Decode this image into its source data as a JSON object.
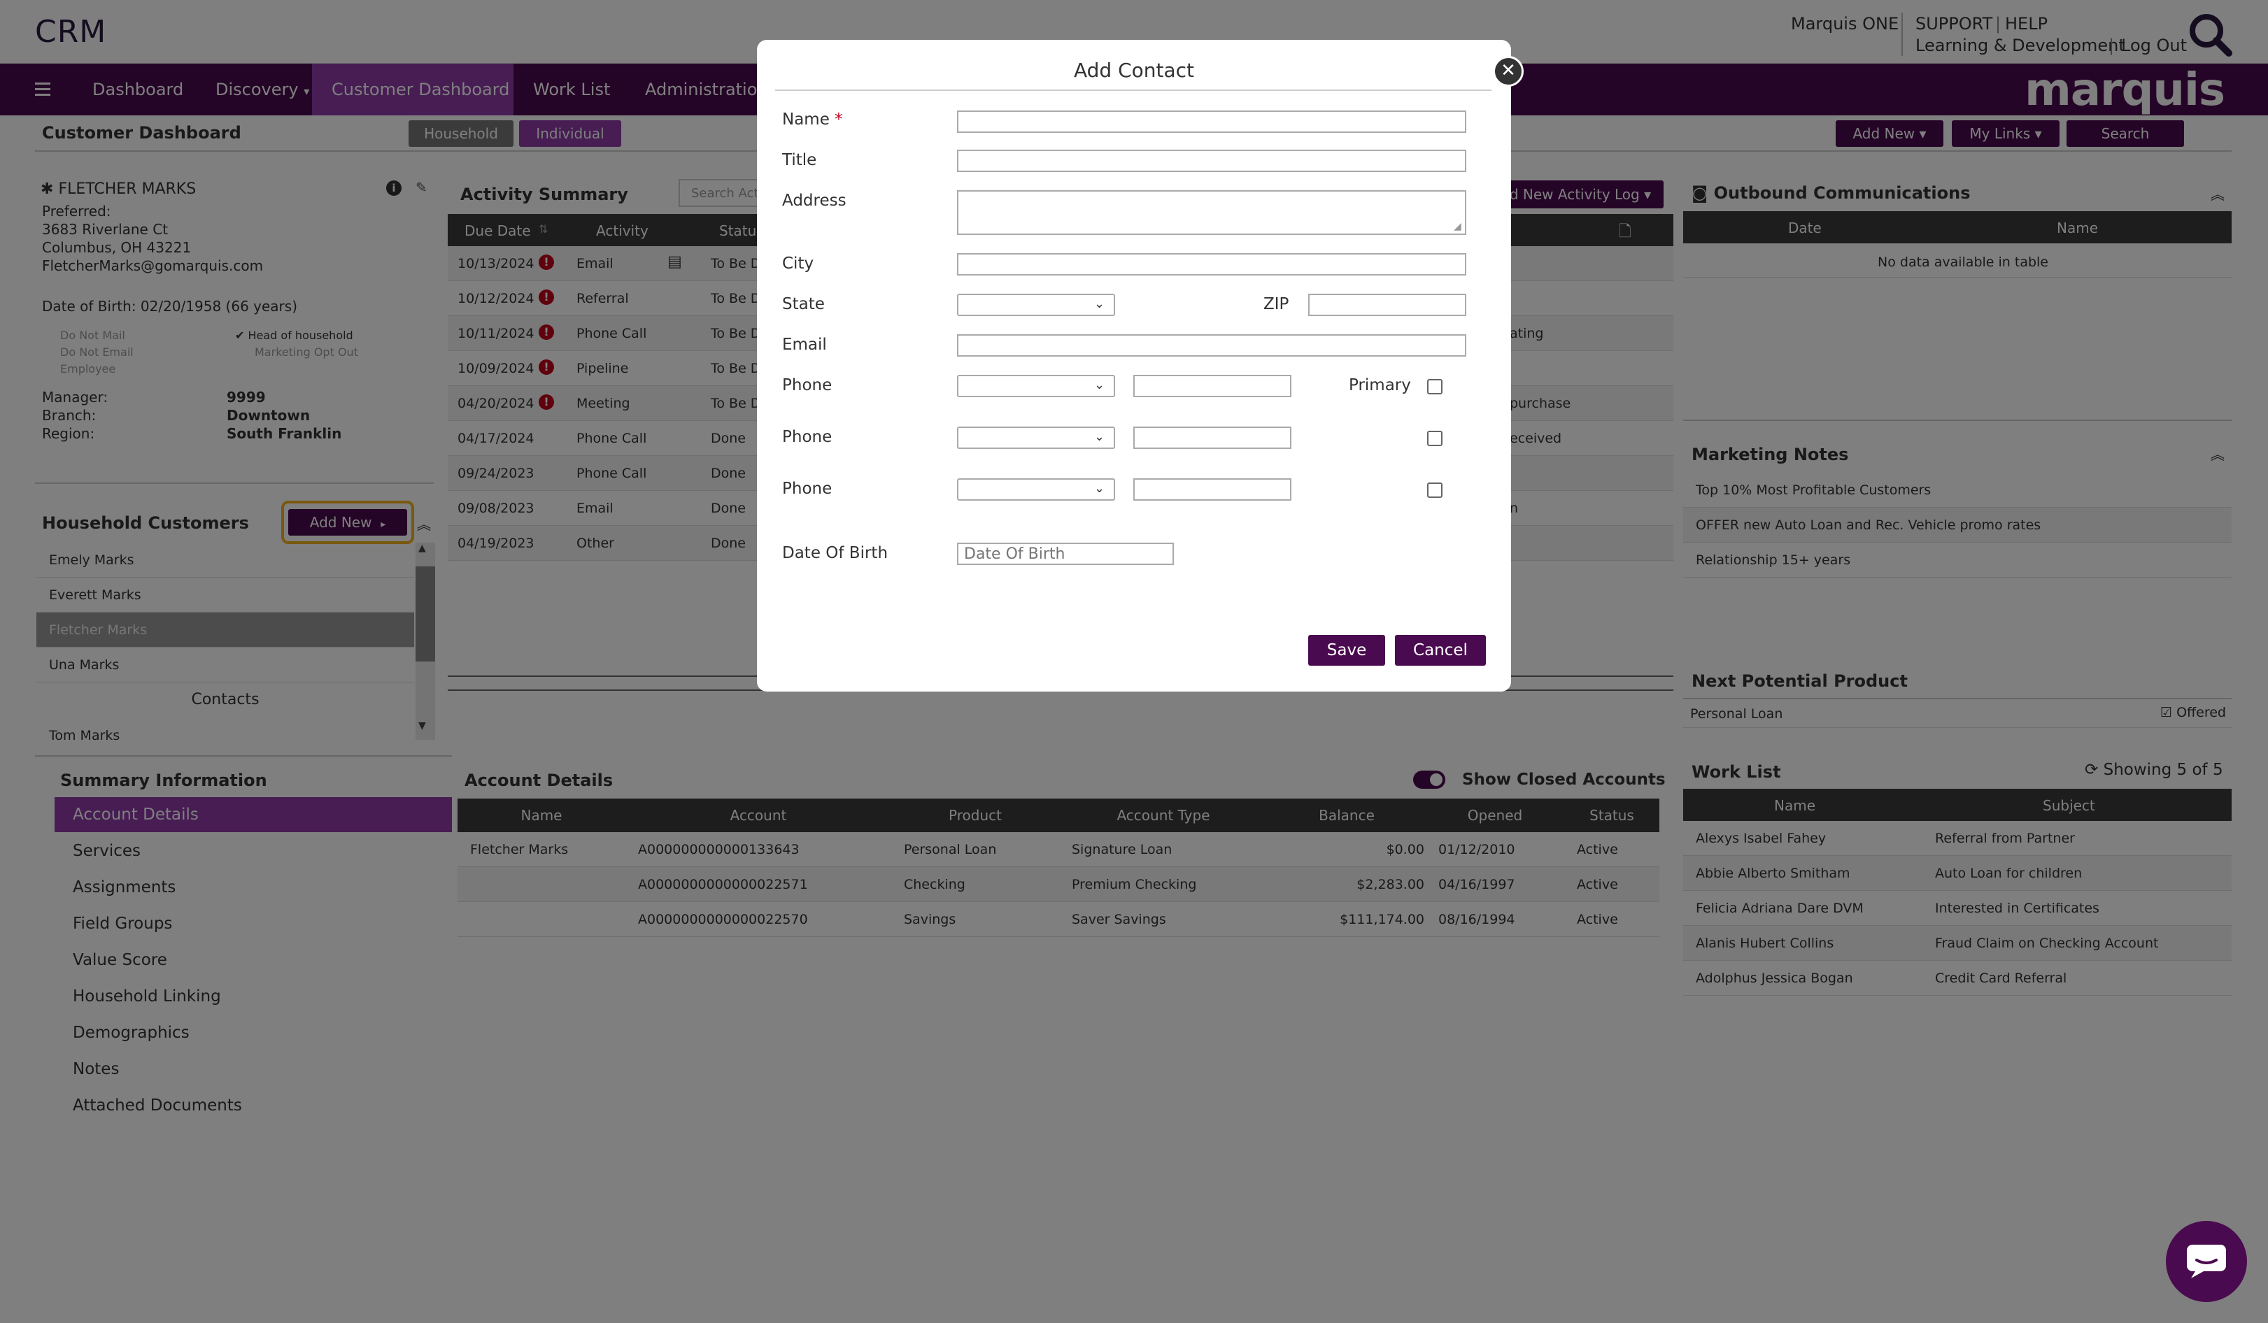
{
  "app": {
    "title": "CRM",
    "brand": "marquis",
    "top_links": {
      "marquis_one": "Marquis ONE",
      "support": "SUPPORT",
      "help": "HELP",
      "learning": "Learning & Development",
      "logout": "Log Out",
      "sep": "|"
    }
  },
  "nav": {
    "items": [
      {
        "label": "Dashboard"
      },
      {
        "label": "Discovery"
      },
      {
        "label": "Customer Dashboard"
      },
      {
        "label": "Work List"
      },
      {
        "label": "Administration"
      }
    ]
  },
  "subheader": {
    "title": "Customer Dashboard",
    "household_tab": "Household",
    "individual_tab": "Individual",
    "add_new": "Add New",
    "my_links": "My Links",
    "search": "Search"
  },
  "customer": {
    "name": "FLETCHER MARKS",
    "preferred_label": "Preferred:",
    "address1": "3683 Riverlane Ct",
    "address2": "Columbus, OH 43221",
    "email": "FletcherMarks@gomarquis.com",
    "dob": "Date of Birth: 02/20/1958 (66 years)",
    "flags": {
      "do_not_mail": "Do Not Mail",
      "do_not_email": "Do Not Email",
      "employee": "Employee",
      "head_of_household": "Head of household",
      "marketing_opt_out": "Marketing Opt Out"
    },
    "manager_label": "Manager:",
    "manager": "9999",
    "branch_label": "Branch:",
    "branch": "Downtown",
    "region_label": "Region:",
    "region": "South Franklin"
  },
  "household": {
    "title": "Household Customers",
    "add_new": "Add New",
    "members": [
      "Emely Marks",
      "Everett Marks",
      "Fletcher Marks",
      "Una Marks"
    ],
    "contacts_label": "Contacts",
    "contacts": [
      "Tom Marks"
    ]
  },
  "summary": {
    "title": "Summary Information",
    "items": [
      "Account Details",
      "Services",
      "Assignments",
      "Field Groups",
      "Value Score",
      "Household Linking",
      "Demographics",
      "Notes",
      "Attached Documents"
    ]
  },
  "activity": {
    "title": "Activity Summary",
    "search_placeholder": "Search Acti",
    "add_log": "d New Activity Log",
    "columns": [
      "Due Date",
      "Activity",
      "Status"
    ],
    "rows": [
      {
        "date": "10/13/2024",
        "activity": "Email",
        "status": "To Be D",
        "overdue": true,
        "extra": ""
      },
      {
        "date": "10/12/2024",
        "activity": "Referral",
        "status": "To Be D",
        "overdue": true,
        "extra": ""
      },
      {
        "date": "10/11/2024",
        "activity": "Phone Call",
        "status": "To Be D",
        "overdue": true,
        "extra": "ating"
      },
      {
        "date": "10/09/2024",
        "activity": "Pipeline",
        "status": "To Be D",
        "overdue": true,
        "extra": ""
      },
      {
        "date": "04/20/2024",
        "activity": "Meeting",
        "status": "To Be D",
        "overdue": true,
        "extra": "purchase"
      },
      {
        "date": "04/17/2024",
        "activity": "Phone Call",
        "status": "Done",
        "overdue": false,
        "extra": "eceived"
      },
      {
        "date": "09/24/2023",
        "activity": "Phone Call",
        "status": "Done",
        "overdue": false,
        "extra": ""
      },
      {
        "date": "09/08/2023",
        "activity": "Email",
        "status": "Done",
        "overdue": false,
        "extra": "n"
      },
      {
        "date": "04/19/2023",
        "activity": "Other",
        "status": "Done",
        "overdue": false,
        "extra": ""
      }
    ]
  },
  "accounts": {
    "title": "Account Details",
    "show_closed": "Show Closed Accounts",
    "columns": [
      "Name",
      "Account",
      "Product",
      "Account Type",
      "Balance",
      "Opened",
      "Status"
    ],
    "rows": [
      {
        "name": "Fletcher Marks",
        "account": "A000000000000133643",
        "product": "Personal Loan",
        "type": "Signature Loan",
        "balance": "$0.00",
        "opened": "01/12/2010",
        "status": "Active"
      },
      {
        "name": "",
        "account": "A0000000000000022571",
        "product": "Checking",
        "type": "Premium Checking",
        "balance": "$2,283.00",
        "opened": "04/16/1997",
        "status": "Active"
      },
      {
        "name": "",
        "account": "A0000000000000022570",
        "product": "Savings",
        "type": "Saver Savings",
        "balance": "$111,174.00",
        "opened": "08/16/1994",
        "status": "Active"
      }
    ]
  },
  "outbound": {
    "title": "Outbound Communications",
    "columns": [
      "Date",
      "Name"
    ],
    "empty": "No data available in table"
  },
  "marketing": {
    "title": "Marketing Notes",
    "notes": [
      "Top 10% Most Profitable Customers",
      "OFFER new Auto Loan and Rec. Vehicle promo rates",
      "Relationship 15+ years"
    ]
  },
  "next_product": {
    "title": "Next Potential Product",
    "product": "Personal Loan",
    "offered": "Offered"
  },
  "worklist": {
    "title": "Work List",
    "showing": "Showing 5 of 5",
    "columns": [
      "Name",
      "Subject"
    ],
    "rows": [
      {
        "name": "Alexys Isabel Fahey",
        "subject": "Referral from Partner"
      },
      {
        "name": "Abbie Alberto Smitham",
        "subject": "Auto Loan for children"
      },
      {
        "name": "Felicia Adriana Dare DVM",
        "subject": "Interested in Certificates"
      },
      {
        "name": "Alanis Hubert Collins",
        "subject": "Fraud Claim on Checking Account"
      },
      {
        "name": "Adolphus Jessica Bogan",
        "subject": "Credit Card Referral"
      }
    ]
  },
  "modal": {
    "title": "Add Contact",
    "name_label": "Name",
    "required_mark": "*",
    "title_label": "Title",
    "address_label": "Address",
    "city_label": "City",
    "state_label": "State",
    "zip_label": "ZIP",
    "email_label": "Email",
    "phone_label": "Phone",
    "primary_label": "Primary",
    "dob_label": "Date Of Birth",
    "dob_placeholder": "Date Of Birth",
    "save": "Save",
    "cancel": "Cancel"
  },
  "colors": {
    "brand": "#4a0a4f",
    "accent": "#8e3aa8",
    "highlight": "#f2b01e",
    "overdue": "#c0001a"
  }
}
